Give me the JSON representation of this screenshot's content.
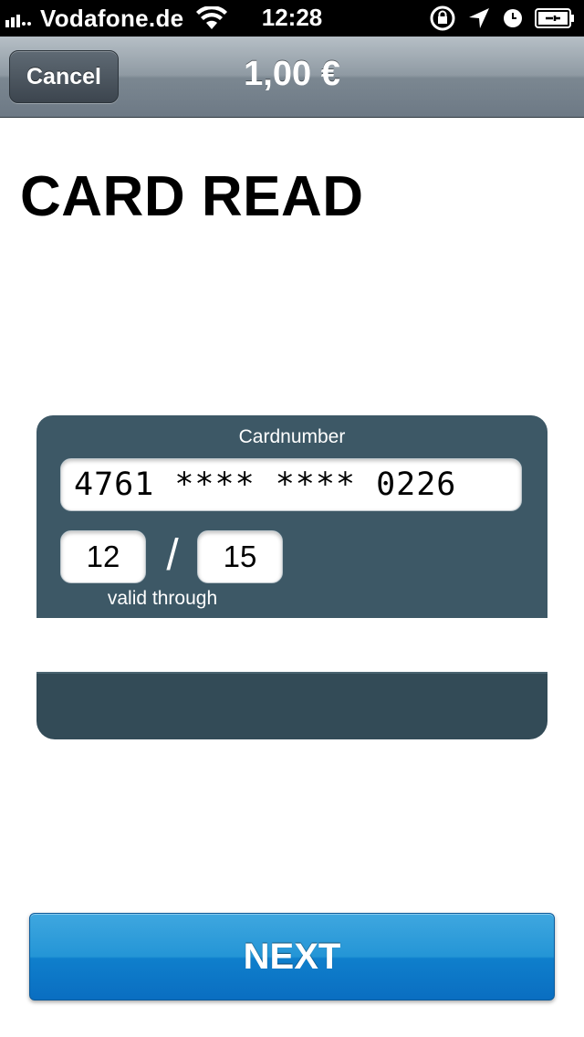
{
  "status_bar": {
    "carrier": "Vodafone.de",
    "time": "12:28",
    "icons": [
      "signal-bars-icon",
      "wifi-icon",
      "rotation-lock-icon",
      "location-arrow-icon",
      "alarm-clock-icon",
      "battery-charging-icon"
    ]
  },
  "navbar": {
    "cancel_label": "Cancel",
    "title": "1,00 €"
  },
  "heading": "CARD READ",
  "card": {
    "cardnumber_label": "Cardnumber",
    "cardnumber_value": "4761 **** **** 0226",
    "exp_month": "12",
    "separator": "/",
    "exp_year": "15",
    "valid_label": "valid through"
  },
  "next_label": "NEXT",
  "colors": {
    "card_bg": "#3d5866",
    "next_button": "#1a8ad4",
    "navbar": "#8f9aa3"
  }
}
